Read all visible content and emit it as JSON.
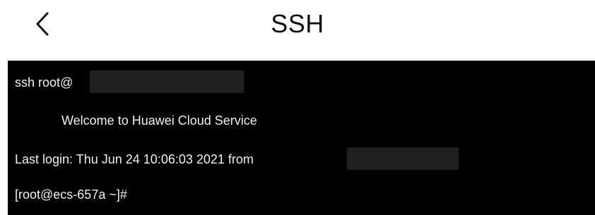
{
  "header": {
    "back_icon": "chevron-left-icon",
    "title": "SSH"
  },
  "terminal": {
    "lines": [
      "ssh root@",
      "Welcome to Huawei Cloud Service",
      "Last login: Thu Jun 24 10:06:03 2021 from",
      "[root@ecs-657a ~]#"
    ],
    "colors": {
      "background": "#000000",
      "text": "#f0f0f0",
      "redaction": "#202020"
    }
  }
}
